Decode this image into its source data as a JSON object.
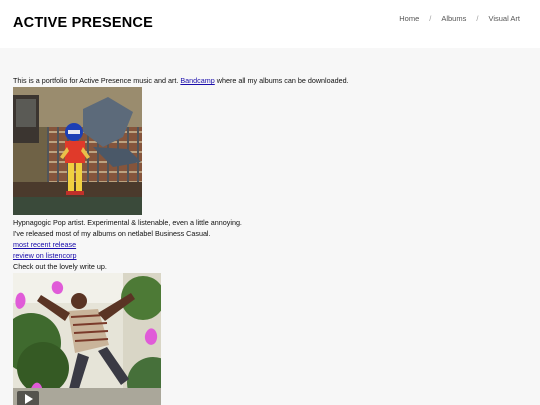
{
  "site": {
    "title": "ACTIVE PRESENCE"
  },
  "nav": {
    "items": [
      "Home",
      "Albums",
      "Visual Art"
    ],
    "separator": "/"
  },
  "content": {
    "intro_before": "This is a portfolio for Active Presence music and art. ",
    "bandcamp_link": "Bandcamp",
    "intro_after": " where all my albums can be downloaded.",
    "line1": "Hypnagogic Pop artist. Experimental & listenable, even a little annoying.",
    "line2": "I've released most of my albums on netlabel Business Casual.",
    "link_recent": "most recent release",
    "link_review": "review on listencorp",
    "line3": "Check out the lovely write up."
  },
  "images": {
    "photo1_icon": "photo-child-costume",
    "photo2_icon": "photo-dancing-man",
    "play_icon": "play-icon"
  }
}
